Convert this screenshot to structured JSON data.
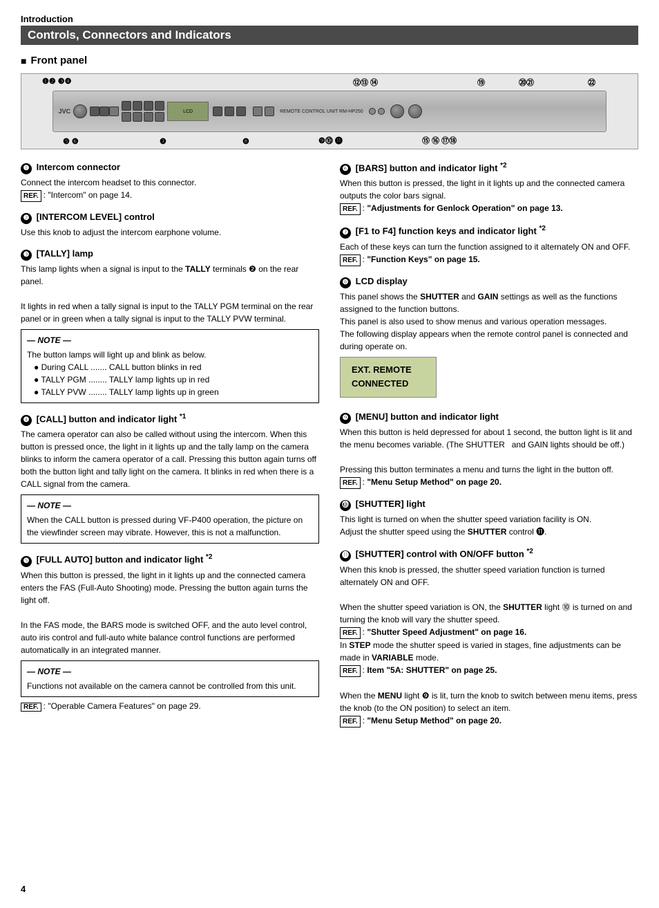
{
  "intro": {
    "label": "Introduction",
    "title": "Controls, Connectors and Indicators",
    "section": "Front panel"
  },
  "items": [
    {
      "num": "1",
      "title": "Intercom connector",
      "body": "Connect the intercom headset to this connector.",
      "ref": "REF.",
      "ref_text": ": \"Intercom\" on page 14."
    },
    {
      "num": "2",
      "title": "[INTERCOM LEVEL] control",
      "body": "Use this knob to adjust the intercom earphone volume.",
      "ref": "",
      "ref_text": ""
    },
    {
      "num": "3",
      "title": "[TALLY] lamp",
      "body_parts": [
        "This lamp lights when a signal is input to the TALLY terminals ❷ on the rear panel.",
        "It lights in red when a tally signal is input to the TALLY PGM terminal on the rear panel or in green when a tally signal is input to the TALLY PVW terminal."
      ],
      "note_title": "NOTE",
      "note_body": "The button lamps will light up and blink as below.",
      "note_bullets": [
        "During CALL ....... CALL button blinks in red",
        "TALLY PGM ........ TALLY lamp lights up in red",
        "TALLY PVW ........ TALLY lamp lights up in green"
      ]
    },
    {
      "num": "4",
      "title": "[CALL] button and indicator light",
      "star": "*1",
      "body_parts": [
        "The camera operator can also be called without using the intercom. When this button is pressed once, the light in it lights up and the tally lamp on the camera blinks to inform the camera operator of a call. Pressing this button again turns off both the button light and tally light on the camera. It blinks in red when there is a CALL signal from the camera."
      ],
      "note_title": "NOTE",
      "note_body": "When the CALL button is pressed during VF-P400 operation, the picture on the viewfinder screen may vibrate. However, this is not a malfunction."
    },
    {
      "num": "5",
      "title": "[FULL AUTO] button and indicator light",
      "star": "*2",
      "body_parts": [
        "When this button is pressed, the light in it lights up and the connected camera enters the FAS (Full-Auto Shooting) mode. Pressing the button again turns the light off.",
        "In the FAS mode, the BARS mode is switched OFF, and the auto level control, auto iris control and full-auto white balance control functions are performed automatically in an integrated manner."
      ],
      "note_title": "NOTE",
      "note_body": "Functions not available on the camera cannot be controlled from this unit.",
      "ref": "REF.",
      "ref_text": ": \"Operable Camera Features\" on page 29."
    },
    {
      "num": "6",
      "title": "[BARS] button and indicator light",
      "star": "*2",
      "body_parts": [
        "When this button is pressed, the light in it lights up and the connected camera outputs the color bars signal."
      ],
      "ref": "REF.",
      "ref_text": ": \"Adjustments for Genlock Operation\" on page 13."
    },
    {
      "num": "7",
      "title": "[F1 to F4] function keys and indicator light",
      "star": "*2",
      "body_parts": [
        "Each of these keys can turn the function assigned to it alternately ON and OFF."
      ],
      "ref": "REF.",
      "ref_text": ": \"Function Keys\" on page 15."
    },
    {
      "num": "8",
      "title": "LCD display",
      "body_parts": [
        "This panel shows the SHUTTER and GAIN settings as well as the functions assigned to the function buttons.",
        "This panel is also used to show menus and various operation messages.",
        "The following display appears when the remote control panel is connected and during operate on."
      ],
      "lcd_line1": "EXT.  REMOTE",
      "lcd_line2": "CONNECTED"
    },
    {
      "num": "9",
      "title": "[MENU] button and indicator light",
      "body_parts": [
        "When this button is held depressed for about 1 second, the button light is lit and the menu becomes variable. (The SHUTTER  and GAIN lights should be off.)",
        "Pressing this button terminates a menu and turns the light in the button off."
      ],
      "ref": "REF.",
      "ref_text": ": \"Menu Setup Method\" on page 20."
    },
    {
      "num": "10",
      "title": "[SHUTTER] light",
      "body_parts": [
        "This light is turned on when the shutter speed variation facility is ON.",
        "Adjust the shutter speed using the SHUTTER control ⓫."
      ]
    },
    {
      "num": "11",
      "title": "[SHUTTER] control with ON/OFF button",
      "star": "*2",
      "body_parts": [
        "When this knob is pressed, the shutter speed variation function is turned alternately ON and OFF.",
        "When the shutter speed variation is ON, the SHUTTER light ⓾ is turned on and turning the knob will vary the shutter speed."
      ],
      "ref": "REF.",
      "ref_text": ": \"Shutter Speed Adjustment\" on page 16.",
      "ref2": "REF.",
      "ref2_text": ": Item \"5A: SHUTTER\" on page 25.",
      "extra": "When the MENU light ❾ is lit, turn the knob to switch between menu items, press the knob (to the ON position) to select an item.",
      "ref3": "REF.",
      "ref3_text": ": \"Menu Setup Method\" on page 20."
    }
  ],
  "panel": {
    "label": "REMOTE CONTROL UNIT RM-HP250",
    "numbers_top": [
      "❶❷ ❸❹",
      "⑫⑬ ⑭",
      "⑲",
      "⑳㉑",
      "㉒"
    ],
    "numbers_bottom": [
      "❺ ❻",
      "❼",
      "❽",
      "❾⓾ ⓫",
      "⑮ ⑯ ⑰⑱"
    ]
  },
  "page_number": "4"
}
